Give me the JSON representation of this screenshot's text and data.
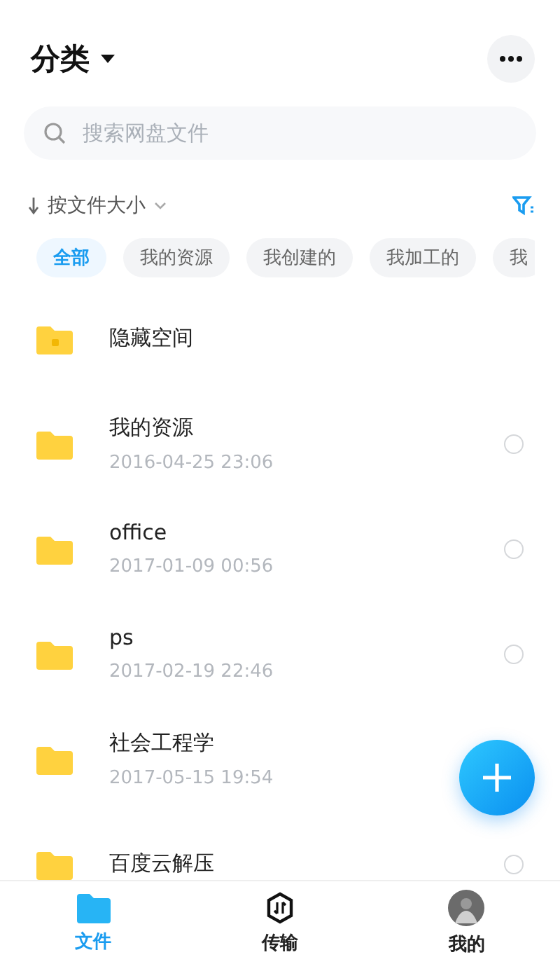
{
  "header": {
    "title": "分类"
  },
  "search": {
    "placeholder": "搜索网盘文件"
  },
  "sort": {
    "label": "按文件大小"
  },
  "chips": [
    {
      "label": "全部",
      "selected": true
    },
    {
      "label": "我的资源",
      "selected": false
    },
    {
      "label": "我创建的",
      "selected": false
    },
    {
      "label": "我加工的",
      "selected": false
    },
    {
      "label": "我",
      "selected": false
    }
  ],
  "files": [
    {
      "kind": "locked",
      "name": "隐藏空间"
    },
    {
      "kind": "folder",
      "name": "我的资源",
      "date": "2016-04-25  23:06",
      "selected": false
    },
    {
      "kind": "folder",
      "name": "office",
      "date": "2017-01-09  00:56",
      "selected": false
    },
    {
      "kind": "folder",
      "name": "ps",
      "date": "2017-02-19  22:46",
      "selected": false
    },
    {
      "kind": "folder",
      "name": "社会工程学",
      "date": "2017-05-15  19:54"
    },
    {
      "kind": "folder",
      "name": "百度云解压",
      "selected": false
    }
  ],
  "tabs": [
    {
      "kind": "files",
      "label": "文件",
      "selected": true
    },
    {
      "kind": "transfer",
      "label": "传输",
      "selected": false
    },
    {
      "kind": "me",
      "label": "我的",
      "selected": false
    }
  ]
}
